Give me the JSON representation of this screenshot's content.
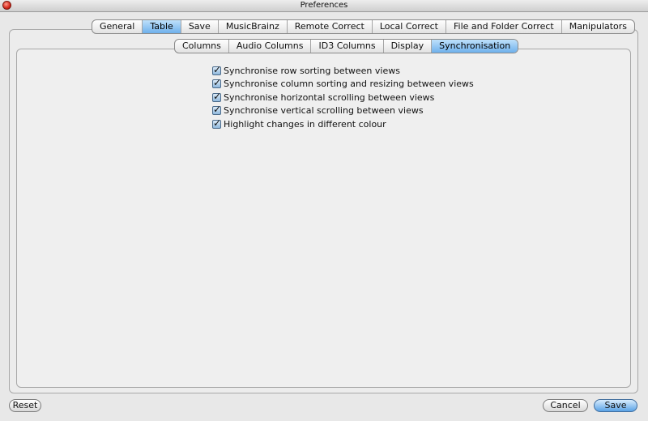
{
  "window": {
    "title": "Preferences"
  },
  "main_tabs": [
    {
      "label": "General",
      "selected": false
    },
    {
      "label": "Table",
      "selected": true
    },
    {
      "label": "Save",
      "selected": false
    },
    {
      "label": "MusicBrainz",
      "selected": false
    },
    {
      "label": "Remote Correct",
      "selected": false
    },
    {
      "label": "Local Correct",
      "selected": false
    },
    {
      "label": "File and Folder Correct",
      "selected": false
    },
    {
      "label": "Manipulators",
      "selected": false
    }
  ],
  "sub_tabs": [
    {
      "label": "Columns",
      "selected": false
    },
    {
      "label": "Audio Columns",
      "selected": false
    },
    {
      "label": "ID3 Columns",
      "selected": false
    },
    {
      "label": "Display",
      "selected": false
    },
    {
      "label": "Synchronisation",
      "selected": true
    }
  ],
  "options": [
    {
      "label": "Synchronise row sorting between views",
      "checked": true
    },
    {
      "label": "Synchronise column sorting and resizing between views",
      "checked": true
    },
    {
      "label": "Synchronise horizontal scrolling between views",
      "checked": true
    },
    {
      "label": "Synchronise vertical scrolling between views",
      "checked": true
    },
    {
      "label": "Highlight changes in different colour",
      "checked": true
    }
  ],
  "buttons": {
    "reset": "Reset",
    "cancel": "Cancel",
    "save": "Save"
  },
  "colors": {
    "selected_tab": "#8cc4f2",
    "default_button": "#5aa2e6",
    "window_bg": "#e8e8e8"
  },
  "icons": {
    "close": "close-icon",
    "checkbox": "checkmark-icon"
  }
}
